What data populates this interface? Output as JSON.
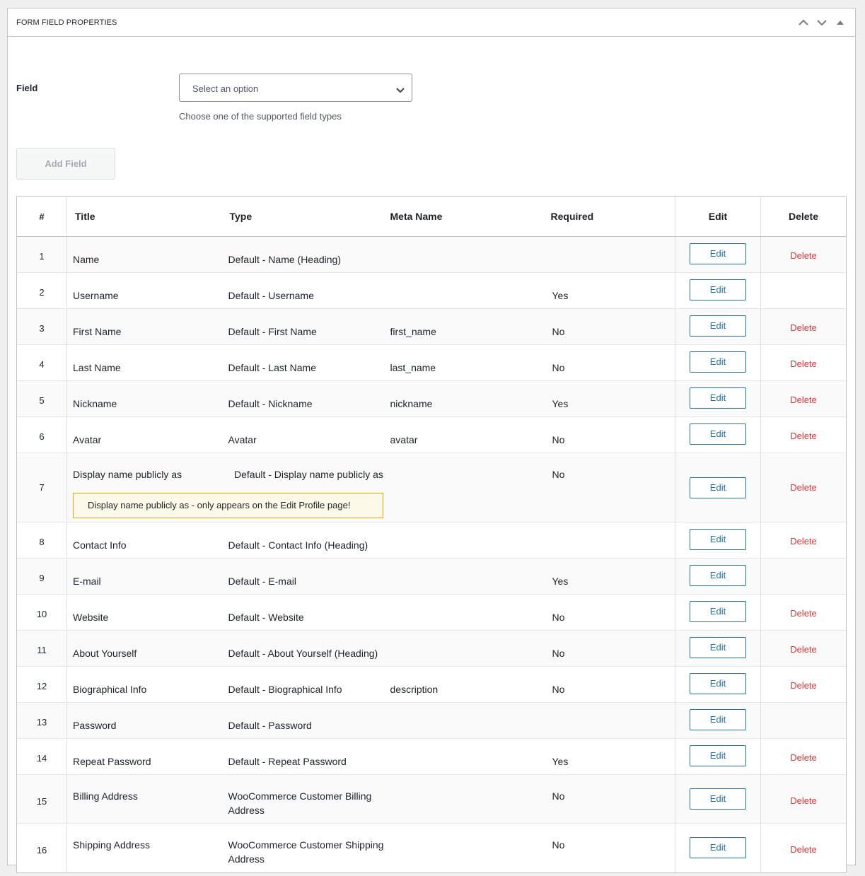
{
  "panel": {
    "title": "FORM FIELD PROPERTIES",
    "controls": [
      "chevron-up-icon",
      "chevron-down-icon",
      "triangle-up-icon"
    ]
  },
  "field": {
    "label": "Field",
    "placeholder": "Select an option",
    "description": "Choose one of the supported field types"
  },
  "add_button": "Add Field",
  "table": {
    "headers": {
      "num": "#",
      "title": "Title",
      "type": "Type",
      "meta": "Meta Name",
      "required": "Required",
      "edit": "Edit",
      "delete": "Delete"
    },
    "edit_label": "Edit",
    "delete_label": "Delete",
    "rows": [
      {
        "num": "1",
        "title": "Name",
        "type": "Default - Name (Heading)",
        "meta": "",
        "required": "",
        "delete": true
      },
      {
        "num": "2",
        "title": "Username",
        "type": "Default - Username",
        "meta": "",
        "required": "Yes",
        "delete": false
      },
      {
        "num": "3",
        "title": "First Name",
        "type": "Default - First Name",
        "meta": "first_name",
        "required": "No",
        "delete": true
      },
      {
        "num": "4",
        "title": "Last Name",
        "type": "Default - Last Name",
        "meta": "last_name",
        "required": "No",
        "delete": true,
        "highlight": true
      },
      {
        "num": "5",
        "title": "Nickname",
        "type": "Default - Nickname",
        "meta": "nickname",
        "required": "Yes",
        "delete": true
      },
      {
        "num": "6",
        "title": "Avatar",
        "type": "Avatar",
        "meta": "avatar",
        "required": "No",
        "delete": true
      },
      {
        "num": "7",
        "title": "Display name publicly as",
        "type": "Default - Display name publicly as",
        "meta": "",
        "required": "No",
        "delete": true,
        "notice": "Display name publicly as - only appears on the Edit Profile page!"
      },
      {
        "num": "8",
        "title": "Contact Info",
        "type": "Default - Contact Info (Heading)",
        "meta": "",
        "required": "",
        "delete": true
      },
      {
        "num": "9",
        "title": "E-mail",
        "type": "Default - E-mail",
        "meta": "",
        "required": "Yes",
        "delete": false
      },
      {
        "num": "10",
        "title": "Website",
        "type": "Default - Website",
        "meta": "",
        "required": "No",
        "delete": true
      },
      {
        "num": "11",
        "title": "About Yourself",
        "type": "Default - About Yourself (Heading)",
        "meta": "",
        "required": "No",
        "delete": true
      },
      {
        "num": "12",
        "title": "Biographical Info",
        "type": "Default - Biographical Info",
        "meta": "description",
        "required": "No",
        "delete": true
      },
      {
        "num": "13",
        "title": "Password",
        "type": "Default - Password",
        "meta": "",
        "required": "",
        "delete": false
      },
      {
        "num": "14",
        "title": "Repeat Password",
        "type": "Default - Repeat Password",
        "meta": "",
        "required": "Yes",
        "delete": true
      },
      {
        "num": "15",
        "title": "Billing Address",
        "type": "WooCommerce Customer Billing Address",
        "meta": "",
        "required": "No",
        "delete": true
      },
      {
        "num": "16",
        "title": "Shipping Address",
        "type": "WooCommerce Customer Shipping Address",
        "meta": "",
        "required": "No",
        "delete": true
      }
    ]
  },
  "colors": {
    "accent": "#2271b1",
    "delete": "#d63638",
    "highlight_row": "#e7f1fd",
    "notice_border": "#dba617",
    "notice_bg": "#fcf9e8"
  }
}
